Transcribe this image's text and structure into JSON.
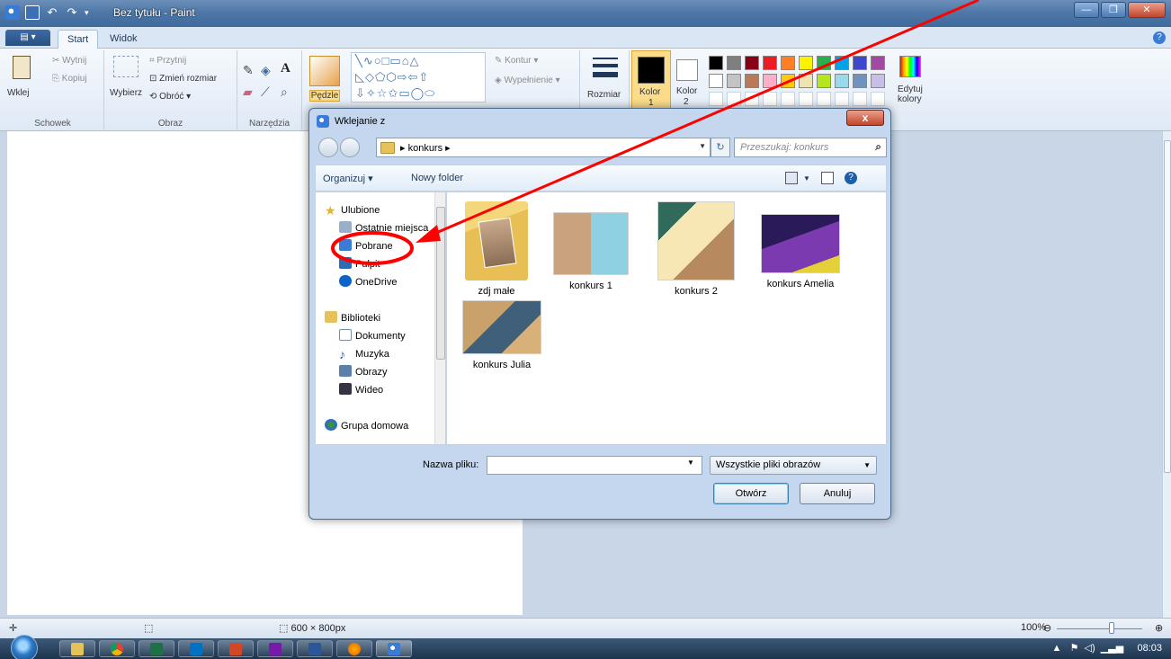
{
  "window": {
    "title": "Bez tytułu - Paint"
  },
  "tabs": [
    "Start",
    "Widok"
  ],
  "ribbon": {
    "clipboard": {
      "paste": "Wklej",
      "cut": "Wytnij",
      "copy": "Kopiuj",
      "label": "Schowek"
    },
    "image": {
      "select": "Wybierz",
      "crop": "Przytnij",
      "resize": "Zmień rozmiar",
      "rotate": "Obróć",
      "label": "Obraz"
    },
    "tools": {
      "label": "Narzędzia"
    },
    "brushes": {
      "label": "Pędzle"
    },
    "shapes": {
      "outline": "Kontur",
      "fill": "Wypełnienie"
    },
    "size": {
      "label": "Rozmiar"
    },
    "color1": {
      "label": "Kolor",
      "num": "1"
    },
    "color2": {
      "label": "Kolor",
      "num": "2"
    },
    "edit_colors": {
      "line1": "Edytuj",
      "line2": "kolory"
    },
    "palette": [
      "#000000",
      "#7f7f7f",
      "#880015",
      "#ed1c24",
      "#ff7f27",
      "#fff200",
      "#22b14c",
      "#00a2e8",
      "#3f48cc",
      "#a349a4",
      "#ffffff",
      "#c3c3c3",
      "#b97a57",
      "#ffaec9",
      "#ffc90e",
      "#efe4b0",
      "#b5e61d",
      "#99d9ea",
      "#7092be",
      "#c8bfe7"
    ]
  },
  "dialog": {
    "title": "Wklejanie z",
    "breadcrumb": "konkurs",
    "search_placeholder": "Przeszukaj: konkurs",
    "toolbar": {
      "organize": "Organizuj ▾",
      "new_folder": "Nowy folder"
    },
    "nav": {
      "favorites": "Ulubione",
      "recent": "Ostatnie miejsca",
      "downloads": "Pobrane",
      "desktop": "Pulpit",
      "onedrive": "OneDrive",
      "libraries": "Biblioteki",
      "documents": "Dokumenty",
      "music": "Muzyka",
      "pictures": "Obrazy",
      "videos": "Wideo",
      "homegroup": "Grupa domowa"
    },
    "files": [
      {
        "name": "zdj małe"
      },
      {
        "name": "konkurs 1"
      },
      {
        "name": "konkurs 2"
      },
      {
        "name": "konkurs Amelia"
      },
      {
        "name": "konkurs Julia"
      }
    ],
    "filename_label": "Nazwa pliku:",
    "filename_value": "",
    "filetype": "Wszystkie pliki obrazów",
    "open": "Otwórz",
    "cancel": "Anuluj"
  },
  "status": {
    "canvas_size": "600 × 800px",
    "zoom": "100%"
  },
  "taskbar": {
    "time": "08:03"
  },
  "annotation": {
    "color": "#ff0000"
  }
}
